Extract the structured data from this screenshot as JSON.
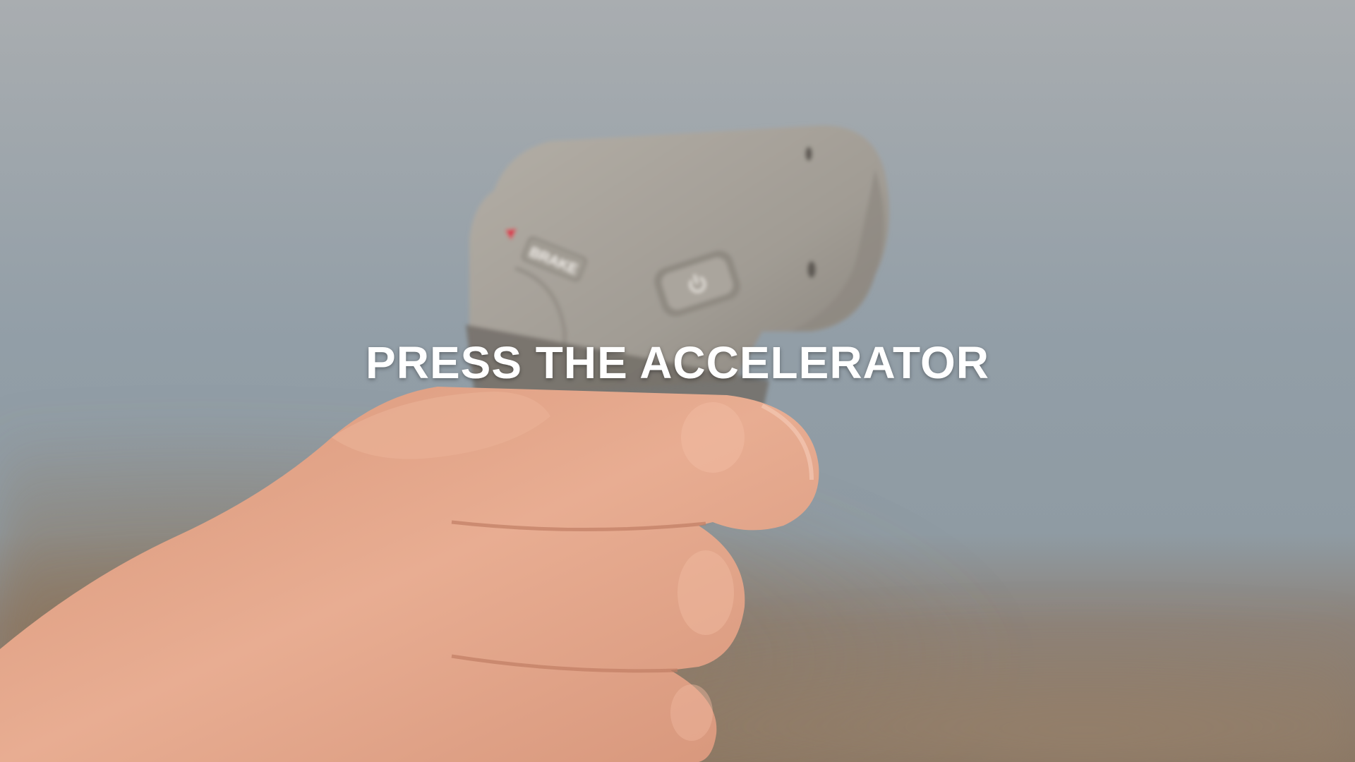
{
  "caption": {
    "text": "PRESS THE ACCELERATOR"
  },
  "remote": {
    "brake_label": "BRAKE",
    "power_icon": "power-icon",
    "indicator_color": "#d8324a"
  },
  "colors": {
    "sky_top": "#a7adb1",
    "sky_mid": "#8e9aa3",
    "ground": "#8c7a66",
    "remote_body": "#a49f97",
    "skin": "#e3a98e",
    "caption": "#ffffff"
  }
}
